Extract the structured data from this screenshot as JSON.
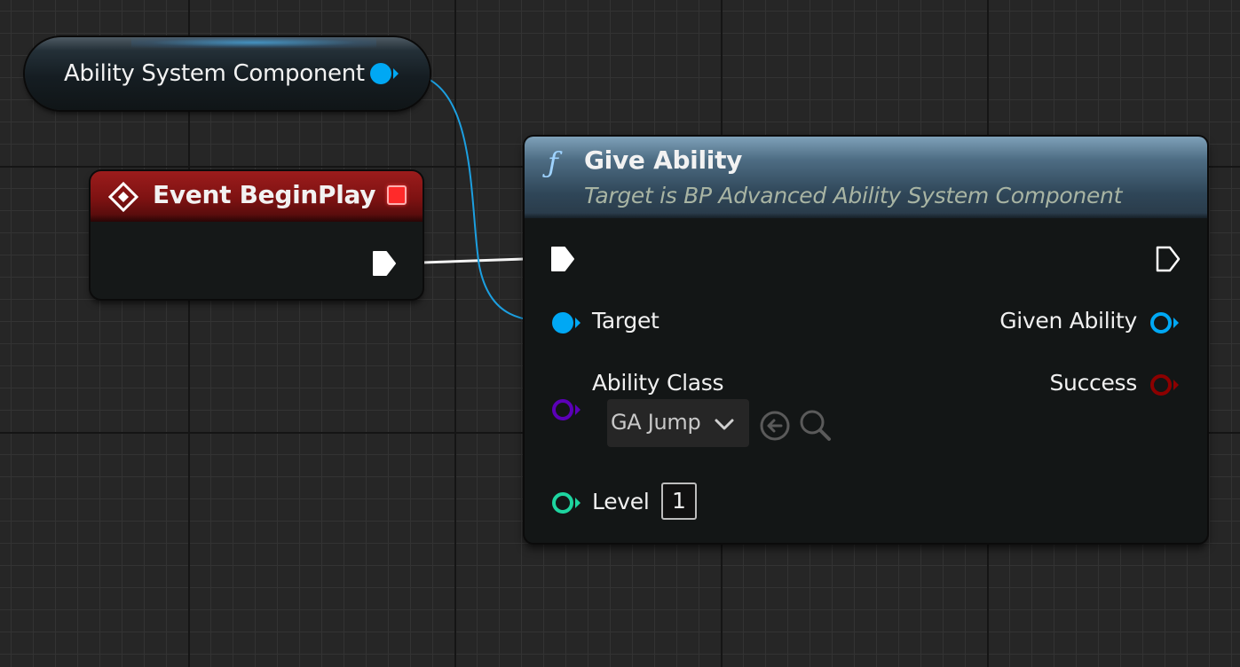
{
  "variable_node": {
    "label": "Ability System Component"
  },
  "event_node": {
    "title": "Event BeginPlay"
  },
  "function_node": {
    "title": "Give Ability",
    "subtitle": "Target is BP Advanced Ability System Component",
    "inputs": {
      "target_label": "Target",
      "ability_class_label": "Ability Class",
      "ability_class_value": "GA Jump",
      "level_label": "Level",
      "level_value": "1"
    },
    "outputs": {
      "given_ability_label": "Given Ability",
      "success_label": "Success"
    }
  },
  "icons": {
    "function": "function-icon",
    "event": "event-diamond-icon",
    "stop": "stop-icon",
    "exec": "exec-pin-icon",
    "dropdown": "chevron-down-icon",
    "use_selected": "use-selected-arrow-icon",
    "browse": "magnifier-icon"
  },
  "colors": {
    "object_pin": "#00a8f4",
    "class_pin": "#5b00b8",
    "int_pin": "#1ed5a0",
    "bool_pin": "#8c0000",
    "event_header": "#9c1c1c",
    "function_header": "#4e6d84",
    "exec_wire": "#ffffff"
  },
  "function_symbol": "ƒ"
}
